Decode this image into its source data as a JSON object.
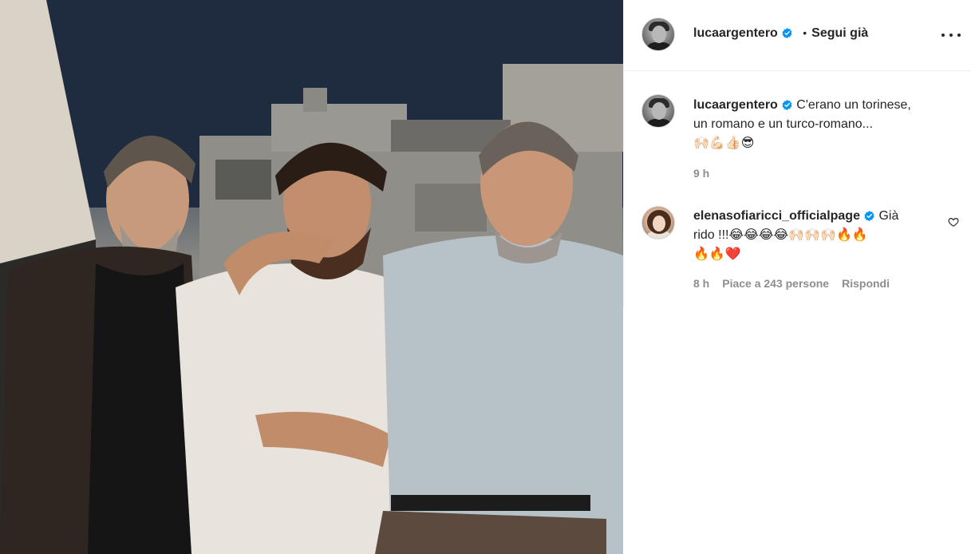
{
  "post": {
    "author": "lucaargentero",
    "follow_label": "Segui già",
    "separator": "•"
  },
  "caption": {
    "username": "lucaargentero",
    "text_line1": "C'erano un torinese,",
    "text_line2": "un romano e un turco-romano...",
    "emojis": "🙌🏻💪🏻👍🏻😎",
    "time": "9 h"
  },
  "comments": [
    {
      "username": "elenasofiaricci_officialpage",
      "text_a": "Già",
      "text_b": "rido !!!😂😂😂😂🙌🏻🙌🏻🙌🏻🔥🔥",
      "text_c": "🔥🔥❤️",
      "time": "8 h",
      "likes": "Piace a 243 persone",
      "reply": "Rispondi"
    }
  ],
  "icons": {
    "verified": "verified-badge-icon",
    "more": "more-options-icon",
    "like": "heart-outline-icon"
  },
  "colors": {
    "verified_blue": "#0095f6",
    "text": "#262626",
    "muted": "#8e8e8e"
  }
}
